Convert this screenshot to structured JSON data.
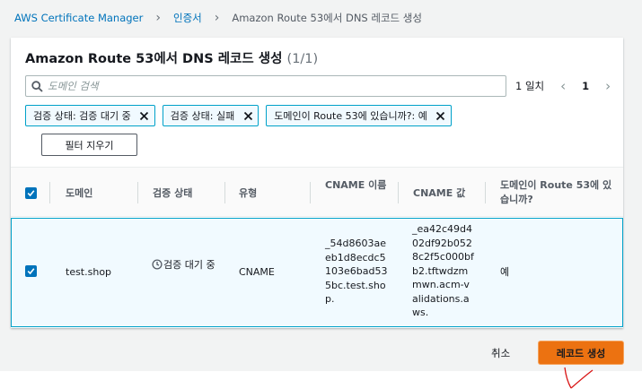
{
  "breadcrumb": {
    "items": [
      "AWS Certificate Manager",
      "인증서",
      "Amazon Route 53에서 DNS 레코드 생성"
    ]
  },
  "panel": {
    "title": "Amazon Route 53에서 DNS 레코드 생성",
    "count": "(1/1)"
  },
  "search": {
    "placeholder": "도메인 검색",
    "value": ""
  },
  "pagination": {
    "match_count": "1 일치",
    "current_page": "1"
  },
  "filters": [
    {
      "label": "검증 상태: 검증 대기 중"
    },
    {
      "label": "검증 상태: 실패"
    },
    {
      "label": "도메인이 Route 53에 있습니까?: 예"
    }
  ],
  "clear_filters_label": "필터 지우기",
  "table": {
    "headers": {
      "domain": "도메인",
      "status": "검증 상태",
      "type": "유형",
      "cname_name": "CNAME 이름",
      "cname_value": "CNAME 값",
      "in_route53": "도메인이 Route 53에 있습니까?"
    },
    "rows": [
      {
        "domain": "test.shop",
        "status": "검증 대기 중",
        "type": "CNAME",
        "cname_name": "_54d8603aeeb1d8ecdc5103e6bad535bc.test.shop.",
        "cname_value": "_ea42c49d402df92b0528c2f5c000bfb2.tftwdzmmwn.acm-validations.aws.",
        "in_route53": "예"
      }
    ]
  },
  "footer": {
    "cancel_label": "취소",
    "create_label": "레코드 생성"
  },
  "colors": {
    "primary_button": "#ec7211",
    "link": "#0073bb",
    "selected_row": "#f1faff",
    "annotation": "#d91515"
  }
}
